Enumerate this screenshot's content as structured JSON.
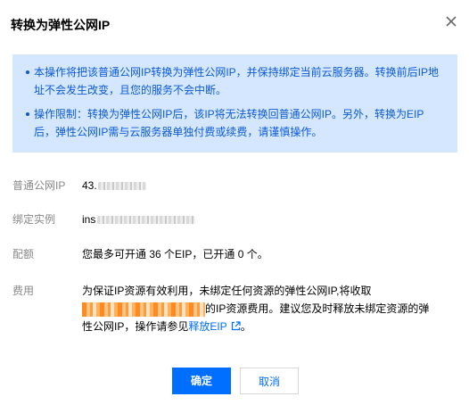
{
  "dialog": {
    "title": "转换为弹性公网IP",
    "notice": [
      "本操作将把该普通公网IP转换为弹性公网IP，并保持绑定当前云服务器。转换前后IP地址不会发生改变，且您的服务不会中断。",
      "操作限制：转换为弹性公网IP后，该IP将无法转换回普通公网IP。另外，转换为EIP后，弹性公网IP需与云服务器单独付费或续费，请谨慎操作。"
    ],
    "fields": {
      "public_ip": {
        "label": "普通公网IP",
        "value_prefix": "43."
      },
      "instance": {
        "label": "绑定实例",
        "value_prefix": "ins"
      },
      "quota": {
        "label": "配额",
        "value": "您最多可开通 36 个EIP，已开通 0 个。"
      },
      "fee": {
        "label": "费用",
        "line1": "为保证IP资源有效利用，未绑定任何资源的弹性公网IP,将收取",
        "line2_suffix": "的IP资源费用。建议您及时释放未绑定资源的弹",
        "line3_prefix": "性公网IP，操作请参见",
        "link": "释放EIP",
        "line3_suffix": "。"
      }
    },
    "buttons": {
      "ok": "确定",
      "cancel": "取消"
    }
  },
  "colors": {
    "primary": "#006eff",
    "notice_bg": "#d5e7ff",
    "notice_text": "#0b5ad6",
    "label": "#888888"
  },
  "icons": {
    "close": "close-icon",
    "external_link": "external-link-icon"
  }
}
